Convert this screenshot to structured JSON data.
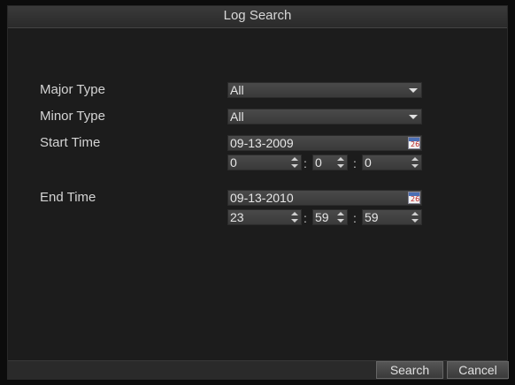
{
  "window": {
    "title": "Log Search"
  },
  "form": {
    "major_type": {
      "label": "Major Type",
      "value": "All"
    },
    "minor_type": {
      "label": "Minor Type",
      "value": "All"
    },
    "start_time": {
      "label": "Start Time",
      "date": "09-13-2009",
      "hour": "0",
      "minute": "0",
      "second": "0"
    },
    "end_time": {
      "label": "End Time",
      "date": "09-13-2010",
      "hour": "23",
      "minute": "59",
      "second": "59"
    },
    "calendar_icon_day": "26",
    "time_separator": ":"
  },
  "buttons": {
    "search": "Search",
    "cancel": "Cancel"
  }
}
